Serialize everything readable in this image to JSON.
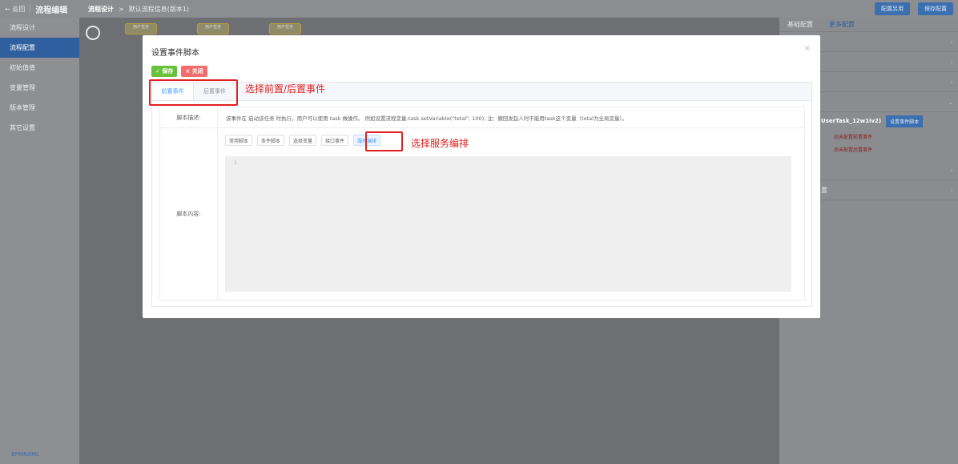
{
  "topbar": {
    "back": "← 返回",
    "title": "流程编辑",
    "crumb_root": "流程设计",
    "crumb_sep": ">",
    "crumb_current": "默认流程信息(版本1)",
    "buttons": [
      "配置另用",
      "保存配置"
    ]
  },
  "sidebar": {
    "items": [
      "流程设计",
      "流程配置",
      "初始值值",
      "变量管理",
      "版本管理",
      "其它设置"
    ],
    "active_index": 1,
    "footer": "BPMNXML"
  },
  "canvas": {
    "nodes": [
      "用户任务",
      "用户任务",
      "用户任务"
    ]
  },
  "right_panel": {
    "tabs": [
      "基础配置",
      "更多配置"
    ],
    "task_name": "UserTask_12w1iv2)",
    "task_button": "设置事件脚本",
    "warnings": [
      "尚未配置前置事件",
      "尚未配置后置事件"
    ],
    "row_label": "置"
  },
  "modal": {
    "title": "设置事件脚本",
    "close": "×",
    "save": "✓ 保存",
    "close_btn": "× 关闭",
    "tabs": [
      "前置事件",
      "后置事件"
    ],
    "desc_label": "脚本描述:",
    "desc_text": "该事件在 启动该任务 时执行，用户可以使用 task 做操作。 例如设置流程变量:task.setVariable(\"total\", 100); 注：撤回发起人时不能用task这个变量（total为全局变量）。",
    "content_label": "脚本内容:",
    "script_buttons": [
      "常用脚本",
      "条件脚本",
      "选择变量",
      "接口事件",
      "服务编排"
    ],
    "line_number": "1"
  },
  "annotations": {
    "tabs_note": "选择前置/后置事件",
    "service_note": "选择服务编排",
    "color": "#e02020"
  }
}
